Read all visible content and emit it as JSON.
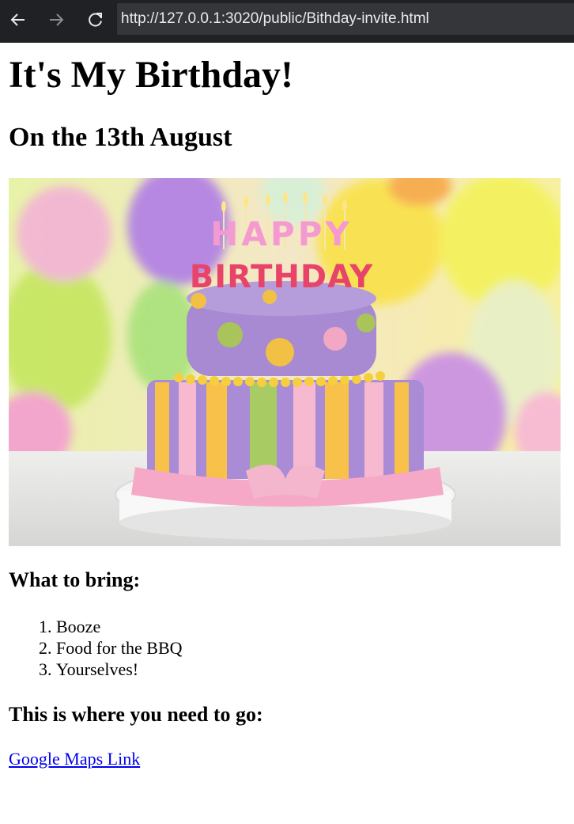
{
  "browser": {
    "url": "http://127.0.0.1:3020/public/Bithday-invite.html",
    "back_icon": "arrow-left-icon",
    "forward_icon": "arrow-right-icon",
    "reload_icon": "reload-icon"
  },
  "page": {
    "heading": "It's My Birthday!",
    "subheading": "On the 13th August",
    "cake_text_line1": "HAPPY",
    "cake_text_line2": "BIRTHDAY",
    "bring_heading": "What to bring:",
    "bring_items": [
      "Booze",
      "Food for the BBQ",
      "Yourselves!"
    ],
    "where_heading": "This is where you need to go:",
    "map_link": "Google Maps Link"
  },
  "colors": {
    "link": "#0000ee",
    "chrome_bg": "#202124",
    "urlbar_bg": "#35363a"
  }
}
